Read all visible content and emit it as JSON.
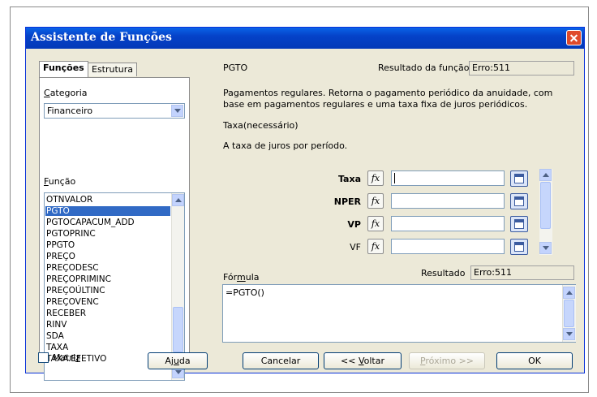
{
  "window": {
    "title": "Assistente de Funções"
  },
  "tabs": [
    {
      "label": "Funções"
    },
    {
      "label": "Estrutura"
    }
  ],
  "category": {
    "label_u": "C",
    "label_rest": "ategoria",
    "value": "Financeiro"
  },
  "function_list": {
    "label_u": "F",
    "label_rest": "unção",
    "items": [
      "OTNVALOR",
      "PGTO",
      "PGTOCAPACUM_ADD",
      "PGTOPRINC",
      "PPGTO",
      "PREÇO",
      "PREÇODESC",
      "PREÇOPRIMINC",
      "PREÇOÚLTINC",
      "PREÇOVENC",
      "RECEBER",
      "RINV",
      "SDA",
      "TAXA",
      "TAXA.EFETIVO"
    ],
    "selected": "PGTO"
  },
  "function_name": "PGTO",
  "result": {
    "label": "Resultado da função",
    "value": "Erro:511"
  },
  "description": "Pagamentos regulares. Retorna o pagamento periódico da anuidade, com base em pagamentos regulares e uma taxa fixa de juros periódicos.",
  "argument": {
    "name": "Taxa(necessário)",
    "description": "A taxa de juros por período."
  },
  "arguments": [
    {
      "label": "Taxa",
      "value": ""
    },
    {
      "label": "NPER",
      "value": ""
    },
    {
      "label": "VP",
      "value": ""
    },
    {
      "label": "VF",
      "value": ""
    }
  ],
  "formula": {
    "label_pre": "Fór",
    "label_u": "m",
    "label_post": "ula",
    "value": "=PGTO()"
  },
  "formula_result": {
    "label": "Resultado",
    "value": "Erro:511"
  },
  "matrix": {
    "label_pre": "Matri",
    "label_u": "z",
    "checked": false
  },
  "buttons": {
    "help_pre": "Aj",
    "help_u": "u",
    "help_post": "da",
    "cancel": "Cancelar",
    "back_pre": "<< ",
    "back_u": "V",
    "back_post": "oltar",
    "next_u": "P",
    "next_post": "róximo >>",
    "ok": "OK"
  },
  "icons": {
    "fx": "fx-icon",
    "shrink": "shrink-dialog-icon"
  }
}
